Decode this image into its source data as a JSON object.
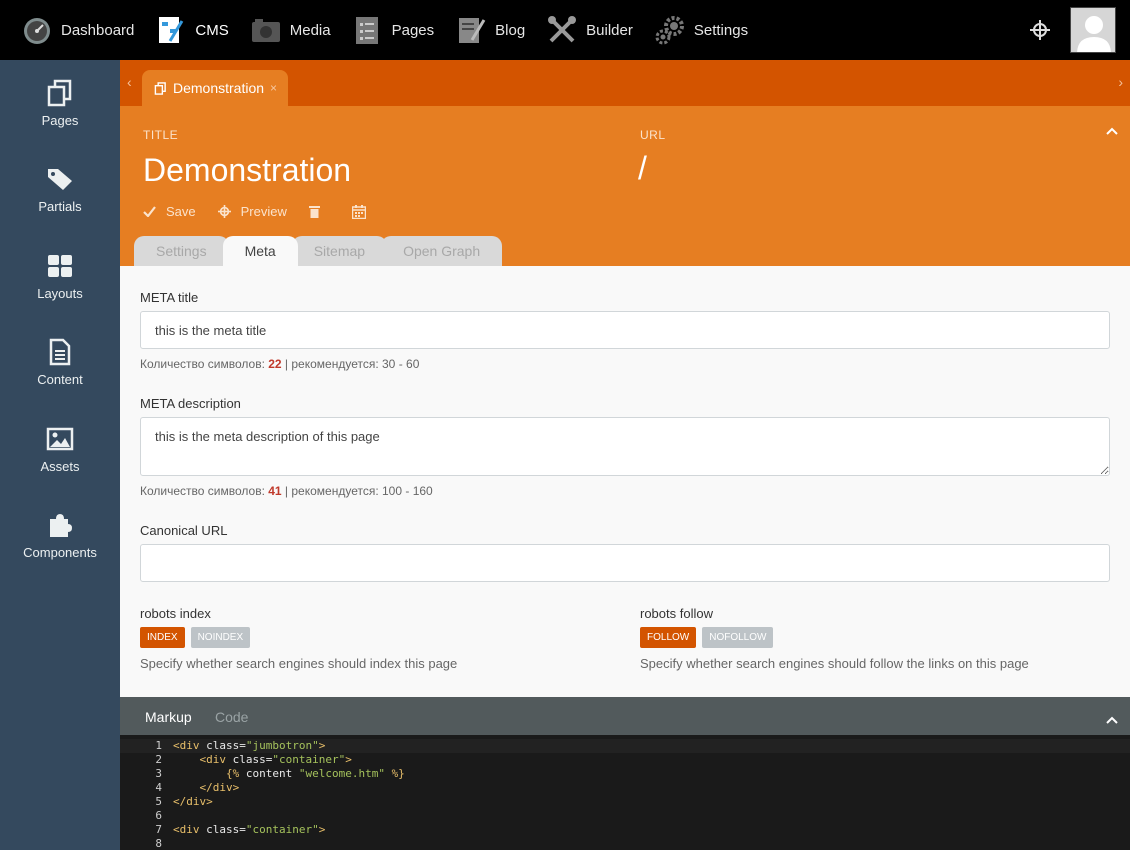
{
  "topnav": {
    "items": [
      {
        "label": "Dashboard",
        "icon": "speedometer-icon"
      },
      {
        "label": "CMS",
        "icon": "cms-icon"
      },
      {
        "label": "Media",
        "icon": "camera-icon"
      },
      {
        "label": "Pages",
        "icon": "checklist-icon"
      },
      {
        "label": "Blog",
        "icon": "document-pen-icon"
      },
      {
        "label": "Builder",
        "icon": "tools-icon"
      },
      {
        "label": "Settings",
        "icon": "gears-icon"
      }
    ],
    "active": "CMS"
  },
  "sidebar": {
    "items": [
      {
        "label": "Pages",
        "icon": "pages-icon"
      },
      {
        "label": "Partials",
        "icon": "tags-icon"
      },
      {
        "label": "Layouts",
        "icon": "grid-icon"
      },
      {
        "label": "Content",
        "icon": "file-text-icon"
      },
      {
        "label": "Assets",
        "icon": "image-icon"
      },
      {
        "label": "Components",
        "icon": "puzzle-icon"
      }
    ]
  },
  "doc_tab": {
    "label": "Demonstration",
    "close": "×"
  },
  "header": {
    "title_label": "TITLE",
    "title_value": "Demonstration",
    "url_label": "URL",
    "url_value": "/",
    "toolbar": {
      "save": "Save",
      "preview": "Preview"
    }
  },
  "form_tabs": [
    "Settings",
    "Meta",
    "Sitemap",
    "Open Graph"
  ],
  "active_form_tab": "Meta",
  "meta_title": {
    "label": "META title",
    "value": "this is the meta title",
    "help_prefix": "Количество символов: ",
    "count": "22",
    "help_suffix": " | рекомендуется: 30 - 60"
  },
  "meta_description": {
    "label": "META description",
    "value": "this is the meta description of this page",
    "help_prefix": "Количество символов: ",
    "count": "41",
    "help_suffix": " | рекомендуется: 100 - 160"
  },
  "canonical": {
    "label": "Canonical URL",
    "value": ""
  },
  "robots_index": {
    "label": "robots index",
    "on": "INDEX",
    "off": "NOINDEX",
    "help": "Specify whether search engines should index this page"
  },
  "robots_follow": {
    "label": "robots follow",
    "on": "FOLLOW",
    "off": "NOFOLLOW",
    "help": "Specify whether search engines should follow the links on this page"
  },
  "editor": {
    "tabs": [
      "Markup",
      "Code"
    ],
    "active": "Markup",
    "lines": [
      "1",
      "2",
      "3",
      "4",
      "5",
      "6",
      "7",
      "8"
    ]
  },
  "colors": {
    "topbar": "#000000",
    "sidebar": "#34495e",
    "tabbar": "#d35400",
    "header": "#e67e22",
    "accent_count": "#c0392b"
  }
}
